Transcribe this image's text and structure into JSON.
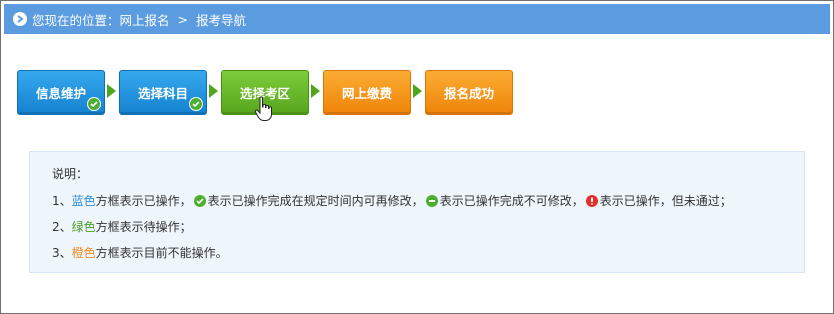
{
  "breadcrumb": {
    "prefix": "您现在的位置：",
    "items": [
      "网上报名",
      "报考导航"
    ],
    "separator": ">"
  },
  "steps": [
    {
      "label": "信息维护",
      "color": "blue",
      "done": true
    },
    {
      "label": "选择科目",
      "color": "blue",
      "done": true
    },
    {
      "label": "选择考区",
      "color": "green",
      "done": false
    },
    {
      "label": "网上缴费",
      "color": "orange",
      "done": false
    },
    {
      "label": "报名成功",
      "color": "orange",
      "done": false
    }
  ],
  "colors": {
    "blue": "#1f8ee0",
    "green": "#5fb323",
    "orange": "#f59a16",
    "header": "#5b9be0"
  },
  "info": {
    "title": "说明：",
    "line1": {
      "num": "1、",
      "color_word": "蓝色",
      "t1": "方框表示已操作，",
      "t2": "表示已操作完成在规定时间内可再修改，",
      "t3": "表示已操作完成不可修改，",
      "t4": "表示已操作，但未通过；"
    },
    "line2": {
      "num": "2、",
      "color_word": "绿色",
      "t1": "方框表示待操作；"
    },
    "line3": {
      "num": "3、",
      "color_word": "橙色",
      "t1": "方框表示目前不能操作。"
    }
  }
}
